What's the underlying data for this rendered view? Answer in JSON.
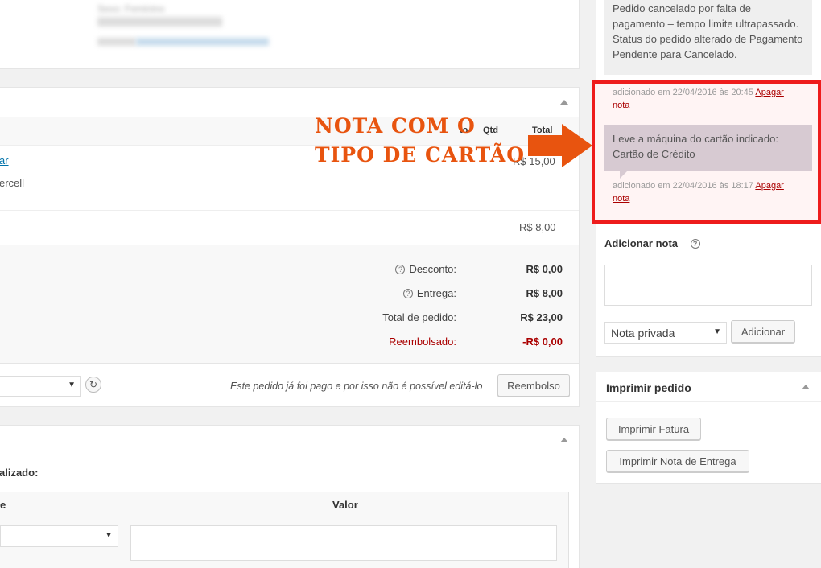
{
  "customer": {
    "sex_label": "Sexo: Feminino"
  },
  "items_table": {
    "col_cost_partial": "to",
    "col_qty": "Qtd",
    "col_total": "Total",
    "item_link_partial": "ar",
    "item_text_partial": "ercell",
    "item_total": "R$ 15,00",
    "shipping_total": "R$ 8,00"
  },
  "totals": {
    "discount_label": "Desconto:",
    "discount_value": "R$ 0,00",
    "shipping_label": "Entrega:",
    "shipping_value": "R$ 8,00",
    "order_total_label": "Total de pedido:",
    "order_total_value": "R$ 23,00",
    "refunded_label": "Reembolsado:",
    "refunded_value": "-R$ 0,00"
  },
  "actions_bar": {
    "info_text": "Este pedido já foi pago e por isso não é possível editá-lo",
    "refund_button": "Reembolso"
  },
  "custom_fields": {
    "label_partial": "alizado:",
    "col_name_partial": "e",
    "col_value": "Valor"
  },
  "notes": {
    "note1_text": "Pedido cancelado por falta de pagamento – tempo limite ultrapassado. Status do pedido alterado de Pagamento Pendente para Cancelado.",
    "note1_meta": "adicionado em 22/04/2016 às 20:45",
    "note2_text": "Leve a máquina do cartão indicado: Cartão de Crédito",
    "note2_meta": "adicionado em 22/04/2016 às 18:17",
    "delete_link_a": "Apagar",
    "delete_link_b": "nota",
    "add_note_label": "Adicionar nota",
    "note_type_selected": "Nota privada",
    "add_button": "Adicionar"
  },
  "print_box": {
    "title": "Imprimir pedido",
    "invoice_button": "Imprimir Fatura",
    "delivery_button": "Imprimir Nota de Entrega"
  },
  "annotation": {
    "line1": "NOTA COM O",
    "line2": "TIPO DE CARTÃO"
  },
  "colors": {
    "highlight_border": "#ee1c1c",
    "arrow": "#e8540f",
    "note_customer_bg": "#d7cad2",
    "note_system_bg": "#efefef"
  }
}
